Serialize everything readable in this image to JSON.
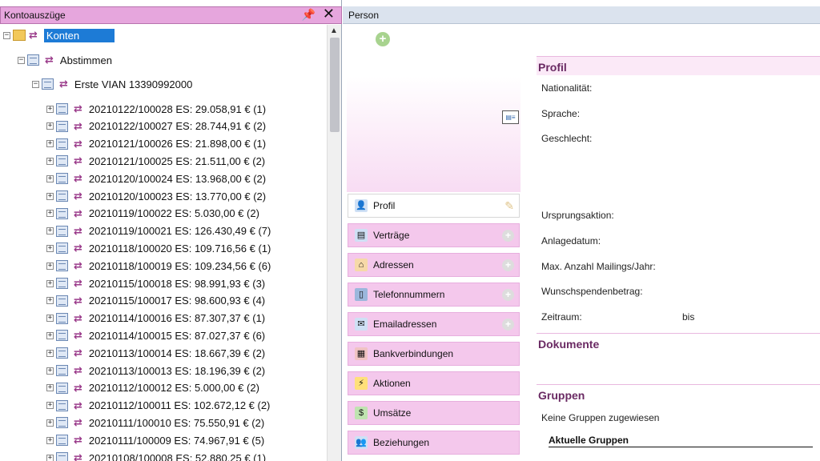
{
  "left_panel": {
    "title": "Kontoauszüge",
    "pin_icon": "pin-icon",
    "close_icon": "close-icon",
    "tree": {
      "root": "Konten",
      "level1": "Abstimmen",
      "level2": "Erste VIAN 13390992000",
      "items": [
        "20210122/100028 ES: 29.058,91 € (1)",
        "20210122/100027 ES: 28.744,91 € (2)",
        "20210121/100026 ES: 21.898,00 € (1)",
        "20210121/100025 ES: 21.511,00 € (2)",
        "20210120/100024 ES: 13.968,00 € (2)",
        "20210120/100023 ES: 13.770,00 € (2)",
        "20210119/100022 ES: 5.030,00 € (2)",
        "20210119/100021 ES: 126.430,49 € (7)",
        "20210118/100020 ES: 109.716,56 € (1)",
        "20210118/100019 ES: 109.234,56 € (6)",
        "20210115/100018 ES: 98.991,93 € (3)",
        "20210115/100017 ES: 98.600,93 € (4)",
        "20210114/100016 ES: 87.307,37 € (1)",
        "20210114/100015 ES: 87.027,37 € (6)",
        "20210113/100014 ES: 18.667,39 € (2)",
        "20210113/100013 ES: 18.196,39 € (2)",
        "20210112/100012 ES: 5.000,00 € (2)",
        "20210112/100011 ES: 102.672,12 € (2)",
        "20210111/100010 ES: 75.550,91 € (2)",
        "20210111/100009 ES: 74.967,91 € (5)",
        "20210108/100008 ES: 52.880,25 € (1)"
      ]
    }
  },
  "right_panel": {
    "title": "Person",
    "nav": [
      {
        "label": "Profil",
        "icon": "person-icon",
        "active": true
      },
      {
        "label": "Verträge",
        "icon": "contract-icon"
      },
      {
        "label": "Adressen",
        "icon": "house-icon"
      },
      {
        "label": "Telefonnummern",
        "icon": "phone-icon"
      },
      {
        "label": "Emailadressen",
        "icon": "envelope-icon"
      },
      {
        "label": "Bankverbindungen",
        "icon": "bank-icon"
      },
      {
        "label": "Aktionen",
        "icon": "lightning-icon"
      },
      {
        "label": "Umsätze",
        "icon": "money-icon"
      },
      {
        "label": "Beziehungen",
        "icon": "people-icon"
      }
    ],
    "profile": {
      "heading": "Profil",
      "fields": {
        "nationality": "Nationalität:",
        "language": "Sprache:",
        "gender": "Geschlecht:",
        "origin_action": "Ursprungsaktion:",
        "created": "Anlagedatum:",
        "max_mailings": "Max. Anzahl Mailings/Jahr:",
        "desired_amount": "Wunschspendenbetrag:",
        "period": "Zeitraum:",
        "period_to": "bis"
      }
    },
    "documents_heading": "Dokumente",
    "groups": {
      "heading": "Gruppen",
      "none_text": "Keine Gruppen zugewiesen",
      "current_label": "Aktuelle Gruppen"
    }
  }
}
